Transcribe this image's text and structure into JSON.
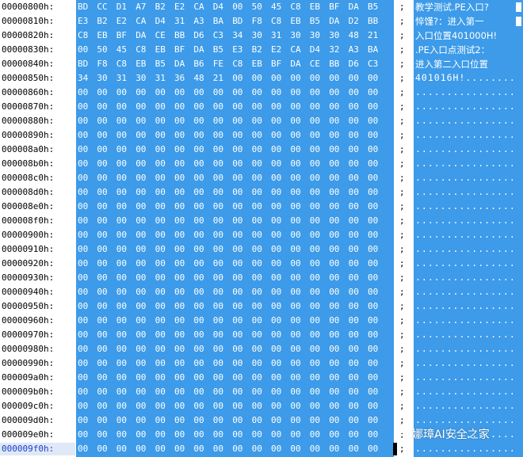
{
  "hex_editor": {
    "current_row_index": 31,
    "block_cursor_rows": [
      0,
      1
    ],
    "rows": [
      {
        "address": "00000800h:",
        "bytes": [
          "BD",
          "CC",
          "D1",
          "A7",
          "B2",
          "E2",
          "CA",
          "D4",
          "00",
          "50",
          "45",
          "C8",
          "EB",
          "BF",
          "DA",
          "B5"
        ],
        "ascii": "教学测试.PE入口?"
      },
      {
        "address": "00000810h:",
        "bytes": [
          "E3",
          "B2",
          "E2",
          "CA",
          "D4",
          "31",
          "A3",
          "BA",
          "BD",
          "F8",
          "C8",
          "EB",
          "B5",
          "DA",
          "D2",
          "BB"
        ],
        "ascii": "悴馑?：进入第一"
      },
      {
        "address": "00000820h:",
        "bytes": [
          "C8",
          "EB",
          "BF",
          "DA",
          "CE",
          "BB",
          "D6",
          "C3",
          "34",
          "30",
          "31",
          "30",
          "30",
          "30",
          "48",
          "21"
        ],
        "ascii": "入口位置401000H!"
      },
      {
        "address": "00000830h:",
        "bytes": [
          "00",
          "50",
          "45",
          "C8",
          "EB",
          "BF",
          "DA",
          "B5",
          "E3",
          "B2",
          "E2",
          "CA",
          "D4",
          "32",
          "A3",
          "BA"
        ],
        "ascii": ".PE入口点测试2："
      },
      {
        "address": "00000840h:",
        "bytes": [
          "BD",
          "F8",
          "C8",
          "EB",
          "B5",
          "DA",
          "B6",
          "FE",
          "C8",
          "EB",
          "BF",
          "DA",
          "CE",
          "BB",
          "D6",
          "C3"
        ],
        "ascii": "进入第二入口位置"
      },
      {
        "address": "00000850h:",
        "bytes": [
          "34",
          "30",
          "31",
          "30",
          "31",
          "36",
          "48",
          "21",
          "00",
          "00",
          "00",
          "00",
          "00",
          "00",
          "00",
          "00"
        ],
        "ascii": "401016H!........"
      },
      {
        "address": "00000860h:",
        "bytes": [
          "00",
          "00",
          "00",
          "00",
          "00",
          "00",
          "00",
          "00",
          "00",
          "00",
          "00",
          "00",
          "00",
          "00",
          "00",
          "00"
        ],
        "ascii": "................"
      },
      {
        "address": "00000870h:",
        "bytes": [
          "00",
          "00",
          "00",
          "00",
          "00",
          "00",
          "00",
          "00",
          "00",
          "00",
          "00",
          "00",
          "00",
          "00",
          "00",
          "00"
        ],
        "ascii": "................"
      },
      {
        "address": "00000880h:",
        "bytes": [
          "00",
          "00",
          "00",
          "00",
          "00",
          "00",
          "00",
          "00",
          "00",
          "00",
          "00",
          "00",
          "00",
          "00",
          "00",
          "00"
        ],
        "ascii": "................"
      },
      {
        "address": "00000890h:",
        "bytes": [
          "00",
          "00",
          "00",
          "00",
          "00",
          "00",
          "00",
          "00",
          "00",
          "00",
          "00",
          "00",
          "00",
          "00",
          "00",
          "00"
        ],
        "ascii": "................"
      },
      {
        "address": "000008a0h:",
        "bytes": [
          "00",
          "00",
          "00",
          "00",
          "00",
          "00",
          "00",
          "00",
          "00",
          "00",
          "00",
          "00",
          "00",
          "00",
          "00",
          "00"
        ],
        "ascii": "................"
      },
      {
        "address": "000008b0h:",
        "bytes": [
          "00",
          "00",
          "00",
          "00",
          "00",
          "00",
          "00",
          "00",
          "00",
          "00",
          "00",
          "00",
          "00",
          "00",
          "00",
          "00"
        ],
        "ascii": "................"
      },
      {
        "address": "000008c0h:",
        "bytes": [
          "00",
          "00",
          "00",
          "00",
          "00",
          "00",
          "00",
          "00",
          "00",
          "00",
          "00",
          "00",
          "00",
          "00",
          "00",
          "00"
        ],
        "ascii": "................"
      },
      {
        "address": "000008d0h:",
        "bytes": [
          "00",
          "00",
          "00",
          "00",
          "00",
          "00",
          "00",
          "00",
          "00",
          "00",
          "00",
          "00",
          "00",
          "00",
          "00",
          "00"
        ],
        "ascii": "................"
      },
      {
        "address": "000008e0h:",
        "bytes": [
          "00",
          "00",
          "00",
          "00",
          "00",
          "00",
          "00",
          "00",
          "00",
          "00",
          "00",
          "00",
          "00",
          "00",
          "00",
          "00"
        ],
        "ascii": "................"
      },
      {
        "address": "000008f0h:",
        "bytes": [
          "00",
          "00",
          "00",
          "00",
          "00",
          "00",
          "00",
          "00",
          "00",
          "00",
          "00",
          "00",
          "00",
          "00",
          "00",
          "00"
        ],
        "ascii": "................"
      },
      {
        "address": "00000900h:",
        "bytes": [
          "00",
          "00",
          "00",
          "00",
          "00",
          "00",
          "00",
          "00",
          "00",
          "00",
          "00",
          "00",
          "00",
          "00",
          "00",
          "00"
        ],
        "ascii": "................"
      },
      {
        "address": "00000910h:",
        "bytes": [
          "00",
          "00",
          "00",
          "00",
          "00",
          "00",
          "00",
          "00",
          "00",
          "00",
          "00",
          "00",
          "00",
          "00",
          "00",
          "00"
        ],
        "ascii": "................"
      },
      {
        "address": "00000920h:",
        "bytes": [
          "00",
          "00",
          "00",
          "00",
          "00",
          "00",
          "00",
          "00",
          "00",
          "00",
          "00",
          "00",
          "00",
          "00",
          "00",
          "00"
        ],
        "ascii": "................"
      },
      {
        "address": "00000930h:",
        "bytes": [
          "00",
          "00",
          "00",
          "00",
          "00",
          "00",
          "00",
          "00",
          "00",
          "00",
          "00",
          "00",
          "00",
          "00",
          "00",
          "00"
        ],
        "ascii": "................"
      },
      {
        "address": "00000940h:",
        "bytes": [
          "00",
          "00",
          "00",
          "00",
          "00",
          "00",
          "00",
          "00",
          "00",
          "00",
          "00",
          "00",
          "00",
          "00",
          "00",
          "00"
        ],
        "ascii": "................"
      },
      {
        "address": "00000950h:",
        "bytes": [
          "00",
          "00",
          "00",
          "00",
          "00",
          "00",
          "00",
          "00",
          "00",
          "00",
          "00",
          "00",
          "00",
          "00",
          "00",
          "00"
        ],
        "ascii": "................"
      },
      {
        "address": "00000960h:",
        "bytes": [
          "00",
          "00",
          "00",
          "00",
          "00",
          "00",
          "00",
          "00",
          "00",
          "00",
          "00",
          "00",
          "00",
          "00",
          "00",
          "00"
        ],
        "ascii": "................"
      },
      {
        "address": "00000970h:",
        "bytes": [
          "00",
          "00",
          "00",
          "00",
          "00",
          "00",
          "00",
          "00",
          "00",
          "00",
          "00",
          "00",
          "00",
          "00",
          "00",
          "00"
        ],
        "ascii": "................"
      },
      {
        "address": "00000980h:",
        "bytes": [
          "00",
          "00",
          "00",
          "00",
          "00",
          "00",
          "00",
          "00",
          "00",
          "00",
          "00",
          "00",
          "00",
          "00",
          "00",
          "00"
        ],
        "ascii": "................"
      },
      {
        "address": "00000990h:",
        "bytes": [
          "00",
          "00",
          "00",
          "00",
          "00",
          "00",
          "00",
          "00",
          "00",
          "00",
          "00",
          "00",
          "00",
          "00",
          "00",
          "00"
        ],
        "ascii": "................"
      },
      {
        "address": "000009a0h:",
        "bytes": [
          "00",
          "00",
          "00",
          "00",
          "00",
          "00",
          "00",
          "00",
          "00",
          "00",
          "00",
          "00",
          "00",
          "00",
          "00",
          "00"
        ],
        "ascii": "................"
      },
      {
        "address": "000009b0h:",
        "bytes": [
          "00",
          "00",
          "00",
          "00",
          "00",
          "00",
          "00",
          "00",
          "00",
          "00",
          "00",
          "00",
          "00",
          "00",
          "00",
          "00"
        ],
        "ascii": "................"
      },
      {
        "address": "000009c0h:",
        "bytes": [
          "00",
          "00",
          "00",
          "00",
          "00",
          "00",
          "00",
          "00",
          "00",
          "00",
          "00",
          "00",
          "00",
          "00",
          "00",
          "00"
        ],
        "ascii": "................"
      },
      {
        "address": "000009d0h:",
        "bytes": [
          "00",
          "00",
          "00",
          "00",
          "00",
          "00",
          "00",
          "00",
          "00",
          "00",
          "00",
          "00",
          "00",
          "00",
          "00",
          "00"
        ],
        "ascii": "................"
      },
      {
        "address": "000009e0h:",
        "bytes": [
          "00",
          "00",
          "00",
          "00",
          "00",
          "00",
          "00",
          "00",
          "00",
          "00",
          "00",
          "00",
          "00",
          "00",
          "00",
          "00"
        ],
        "ascii": "................"
      },
      {
        "address": "000009f0h:",
        "bytes": [
          "00",
          "00",
          "00",
          "00",
          "00",
          "00",
          "00",
          "00",
          "00",
          "00",
          "00",
          "00",
          "00",
          "00",
          "00",
          "00"
        ],
        "ascii": "................"
      }
    ],
    "separator": ";"
  },
  "watermark": {
    "text": "娜璋AI安全之家",
    "icon": "wechat-icon"
  },
  "colors": {
    "selection": "#3d9be9",
    "selected_text": "#ffffff",
    "address_text": "#000000",
    "current_address_text": "#1a3fd0"
  }
}
